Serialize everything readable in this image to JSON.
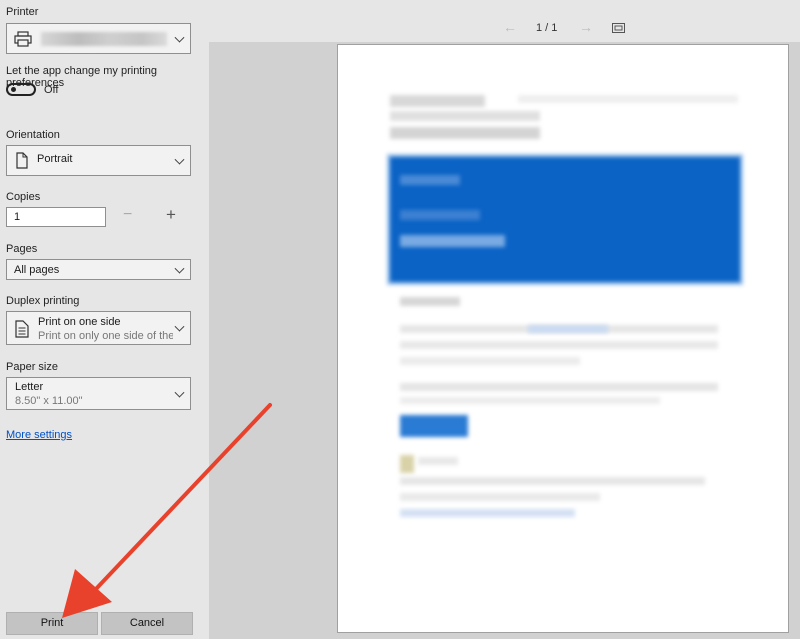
{
  "printer": {
    "label": "Printer"
  },
  "app_pref": {
    "label": "Let the app change my printing preferences",
    "toggle_state": "Off"
  },
  "orientation": {
    "label": "Orientation",
    "value": "Portrait"
  },
  "copies": {
    "label": "Copies",
    "value": "1",
    "minus": "−",
    "plus": "+"
  },
  "pages": {
    "label": "Pages",
    "value": "All pages"
  },
  "duplex": {
    "label": "Duplex printing",
    "value": "Print on one side",
    "sub": "Print on only one side of the pa"
  },
  "paper": {
    "label": "Paper size",
    "value": "Letter",
    "sub": "8.50\" x 11.00\""
  },
  "more_settings": "More settings",
  "buttons": {
    "print": "Print",
    "cancel": "Cancel"
  },
  "preview_nav": {
    "prev": "←",
    "page": "1 / 1",
    "next": "→"
  },
  "colors": {
    "accent": "#0b63c5",
    "arrow": "#e8412c",
    "link": "#0050c8"
  },
  "icons": [
    "printer-icon",
    "document-icon",
    "duplex-document-icon",
    "chevron-down-icon",
    "fit-page-icon"
  ]
}
